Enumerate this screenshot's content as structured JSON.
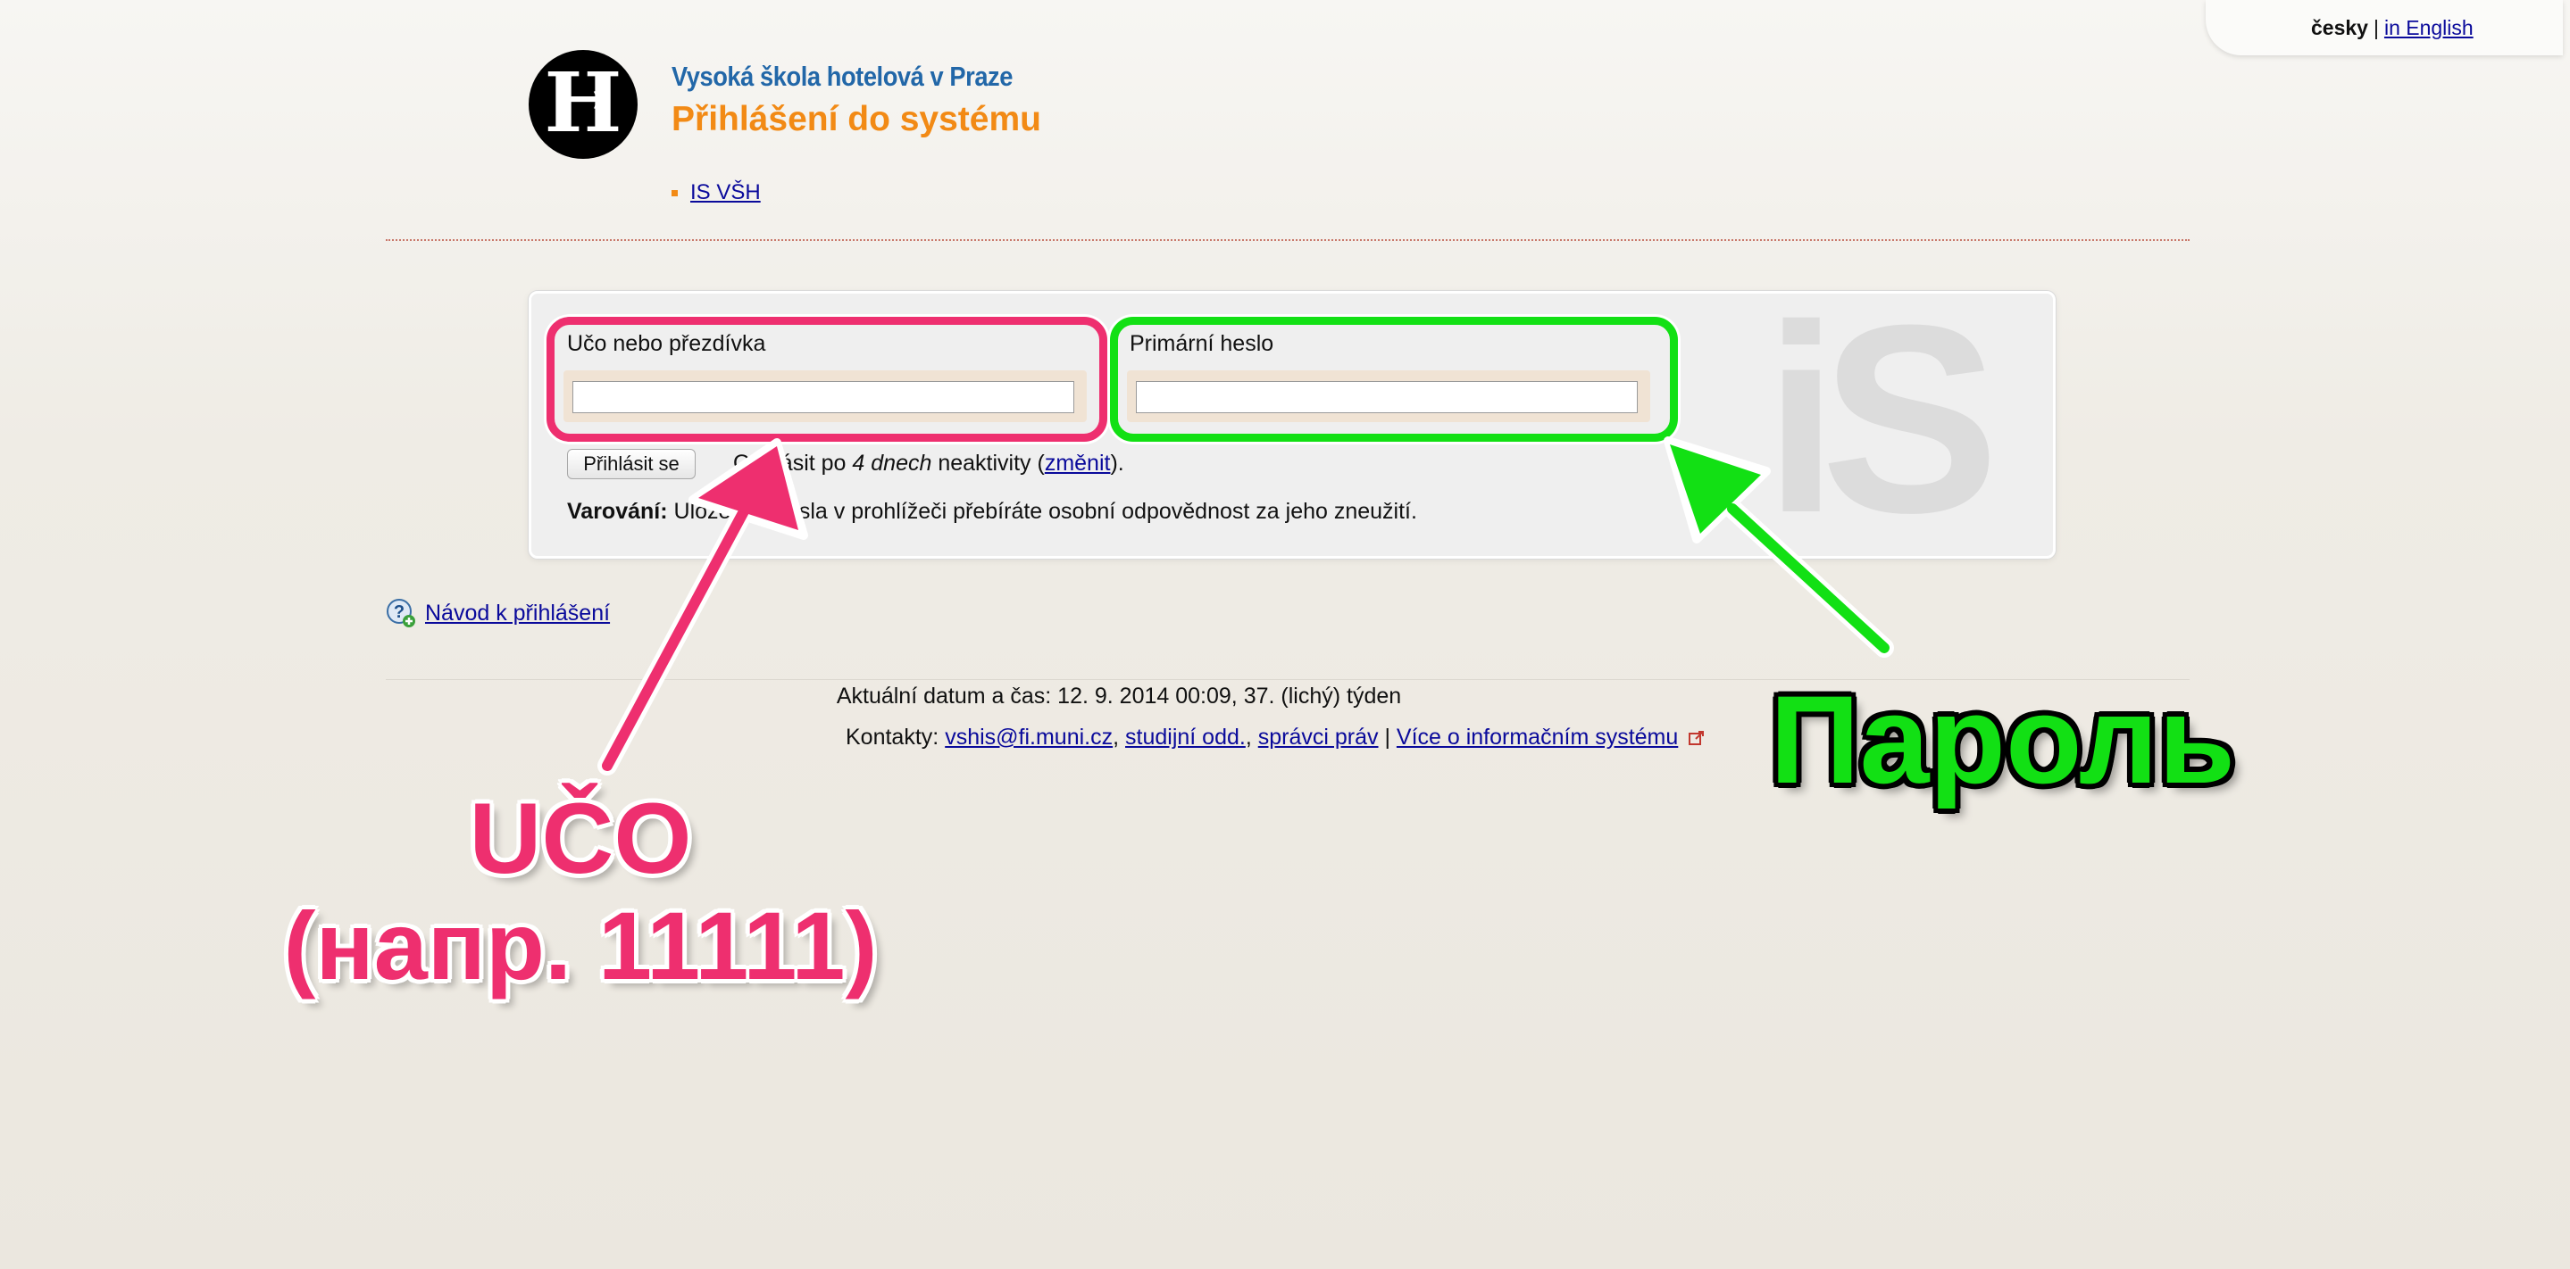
{
  "lang": {
    "current": "česky",
    "separator": "|",
    "other": "in English"
  },
  "header": {
    "school_name": "Vysoká škola hotelová v Praze",
    "page_title": "Přihlášení do systému",
    "nav_link": "IS VŠH"
  },
  "login": {
    "username_label": "Učo nebo přezdívka",
    "username_value": "",
    "password_label": "Primární heslo",
    "password_value": "",
    "submit_label": "Přihlásit se",
    "logout_prefix": "Odhlásit po",
    "logout_duration": "4 dnech",
    "logout_suffix": "neaktivity (",
    "logout_change_link": "změnit",
    "logout_end": ").",
    "warning_label": "Varování:",
    "warning_text": "Uložením hesla v prohlížeči přebíráte osobní odpovědnost za jeho zneužití.",
    "watermark": "iS"
  },
  "help": {
    "link": "Návod k přihlášení"
  },
  "footer": {
    "datetime": "Aktuální datum a čas: 12. 9. 2014 00:09, 37. (lichý) týden",
    "contacts_label": "Kontakty:",
    "contact_email": "vshis@fi.muni.cz",
    "contact_study": "studijní odd.",
    "contact_admins": "správci práv",
    "more_link": "Více o informačním systému"
  },
  "annotations": {
    "uco_line1": "UČO",
    "uco_line2": "(напр. 11111)",
    "password": "Пароль",
    "uco_color": "#ee2f6f",
    "password_color": "#12e014"
  },
  "colors": {
    "accent_orange": "#f28a15",
    "school_blue": "#2267a8",
    "link": "#0a0a9b"
  }
}
